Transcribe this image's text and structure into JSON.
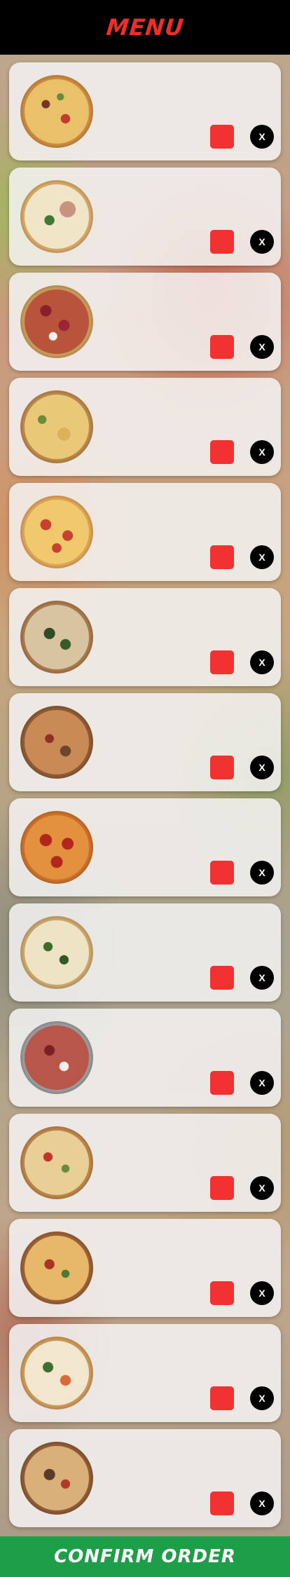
{
  "header": {
    "title": "MENU"
  },
  "colors": {
    "header_bg": "#000000",
    "title_red": "#f22b2b",
    "add_button": "#f23131",
    "confirm_green": "#1f9e4a"
  },
  "menu": {
    "items": [
      {
        "image": "pizza-1",
        "remove_label": "X"
      },
      {
        "image": "pizza-2",
        "remove_label": "X"
      },
      {
        "image": "pizza-3",
        "remove_label": "X"
      },
      {
        "image": "pizza-4",
        "remove_label": "X"
      },
      {
        "image": "pizza-5",
        "remove_label": "X"
      },
      {
        "image": "pizza-6",
        "remove_label": "X"
      },
      {
        "image": "pizza-7",
        "remove_label": "X"
      },
      {
        "image": "pizza-8",
        "remove_label": "X"
      },
      {
        "image": "pizza-9",
        "remove_label": "X"
      },
      {
        "image": "pizza-10",
        "remove_label": "X"
      },
      {
        "image": "pizza-11",
        "remove_label": "X"
      },
      {
        "image": "pizza-12",
        "remove_label": "X"
      },
      {
        "image": "pizza-13",
        "remove_label": "X"
      },
      {
        "image": "pizza-14",
        "remove_label": "X"
      }
    ]
  },
  "footer": {
    "confirm_label": "CONFIRM ORDER"
  }
}
